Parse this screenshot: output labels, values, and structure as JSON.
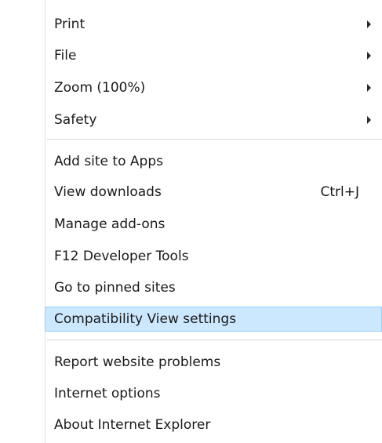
{
  "menu": {
    "items": [
      {
        "label": "Print",
        "shortcut": "",
        "submenu": true
      },
      {
        "label": "File",
        "shortcut": "",
        "submenu": true
      },
      {
        "label": "Zoom (100%)",
        "shortcut": "",
        "submenu": true
      },
      {
        "label": "Safety",
        "shortcut": "",
        "submenu": true
      },
      {
        "label": "Add site to Apps",
        "shortcut": "",
        "submenu": false
      },
      {
        "label": "View downloads",
        "shortcut": "Ctrl+J",
        "submenu": false
      },
      {
        "label": "Manage add-ons",
        "shortcut": "",
        "submenu": false
      },
      {
        "label": "F12 Developer Tools",
        "shortcut": "",
        "submenu": false
      },
      {
        "label": "Go to pinned sites",
        "shortcut": "",
        "submenu": false
      },
      {
        "label": "Compatibility View settings",
        "shortcut": "",
        "submenu": false,
        "highlighted": true
      },
      {
        "label": "Report website problems",
        "shortcut": "",
        "submenu": false
      },
      {
        "label": "Internet options",
        "shortcut": "",
        "submenu": false
      },
      {
        "label": "About Internet Explorer",
        "shortcut": "",
        "submenu": false
      }
    ]
  },
  "colors": {
    "highlight_bg": "#cce8ff",
    "highlight_border": "#99d1ff",
    "separator": "#d7d7d7",
    "text": "#1a1a1a"
  }
}
